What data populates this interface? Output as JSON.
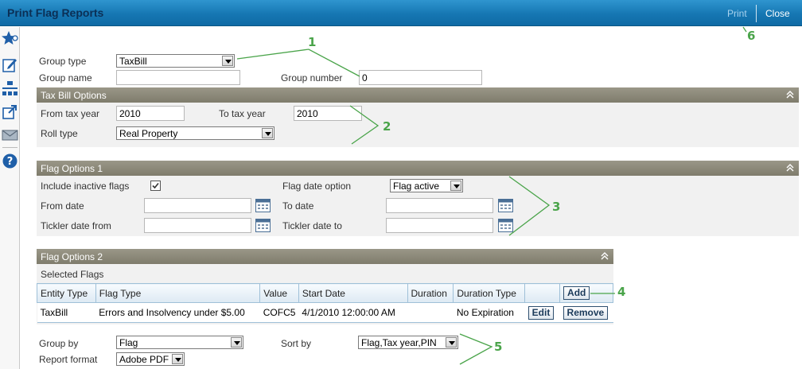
{
  "window": {
    "title": "Print Flag Reports",
    "print_label": "Print",
    "close_label": "Close"
  },
  "sidebar": {
    "icons": [
      "favorite-star-icon",
      "edit-note-icon",
      "hierarchy-icon",
      "external-link-icon",
      "mail-icon",
      "help-icon"
    ]
  },
  "form": {
    "group_type_label": "Group type",
    "group_type_value": "TaxBill",
    "group_name_label": "Group name",
    "group_name_value": "",
    "group_number_label": "Group number",
    "group_number_value": "0"
  },
  "tax_bill": {
    "title": "Tax Bill Options",
    "from_label": "From tax year",
    "from_value": "2010",
    "to_label": "To tax year",
    "to_value": "2010",
    "roll_label": "Roll type",
    "roll_value": "Real Property"
  },
  "flag1": {
    "title": "Flag Options 1",
    "include_inactive_label": "Include inactive flags",
    "include_inactive_checked": true,
    "date_option_label": "Flag date option",
    "date_option_value": "Flag active",
    "from_date_label": "From date",
    "from_date_value": "",
    "to_date_label": "To date",
    "to_date_value": "",
    "tickler_from_label": "Tickler date from",
    "tickler_from_value": "",
    "tickler_to_label": "Tickler date to",
    "tickler_to_value": ""
  },
  "flag2": {
    "title": "Flag Options 2",
    "selected_label": "Selected Flags",
    "columns": [
      "Entity Type",
      "Flag Type",
      "Value",
      "Start Date",
      "Duration",
      "Duration Type"
    ],
    "add_label": "Add",
    "rows": [
      {
        "entity": "TaxBill",
        "flag_type": "Errors and Insolvency under $5.00",
        "value": "COFC5",
        "start": "4/1/2010 12:00:00 AM",
        "duration": "",
        "duration_type": "No Expiration"
      }
    ],
    "edit_label": "Edit",
    "remove_label": "Remove"
  },
  "footer": {
    "group_by_label": "Group by",
    "group_by_value": "Flag",
    "sort_by_label": "Sort by",
    "sort_by_value": "Flag,Tax year,PIN",
    "report_format_label": "Report format",
    "report_format_value": "Adobe PDF"
  },
  "annotations": {
    "n1": "1",
    "n2": "2",
    "n3": "3",
    "n4": "4",
    "n5": "5",
    "n6": "6"
  },
  "colors": {
    "title_bar": "#1677b3",
    "section_bar": "#8a8777",
    "annotation": "#4aa44a"
  }
}
